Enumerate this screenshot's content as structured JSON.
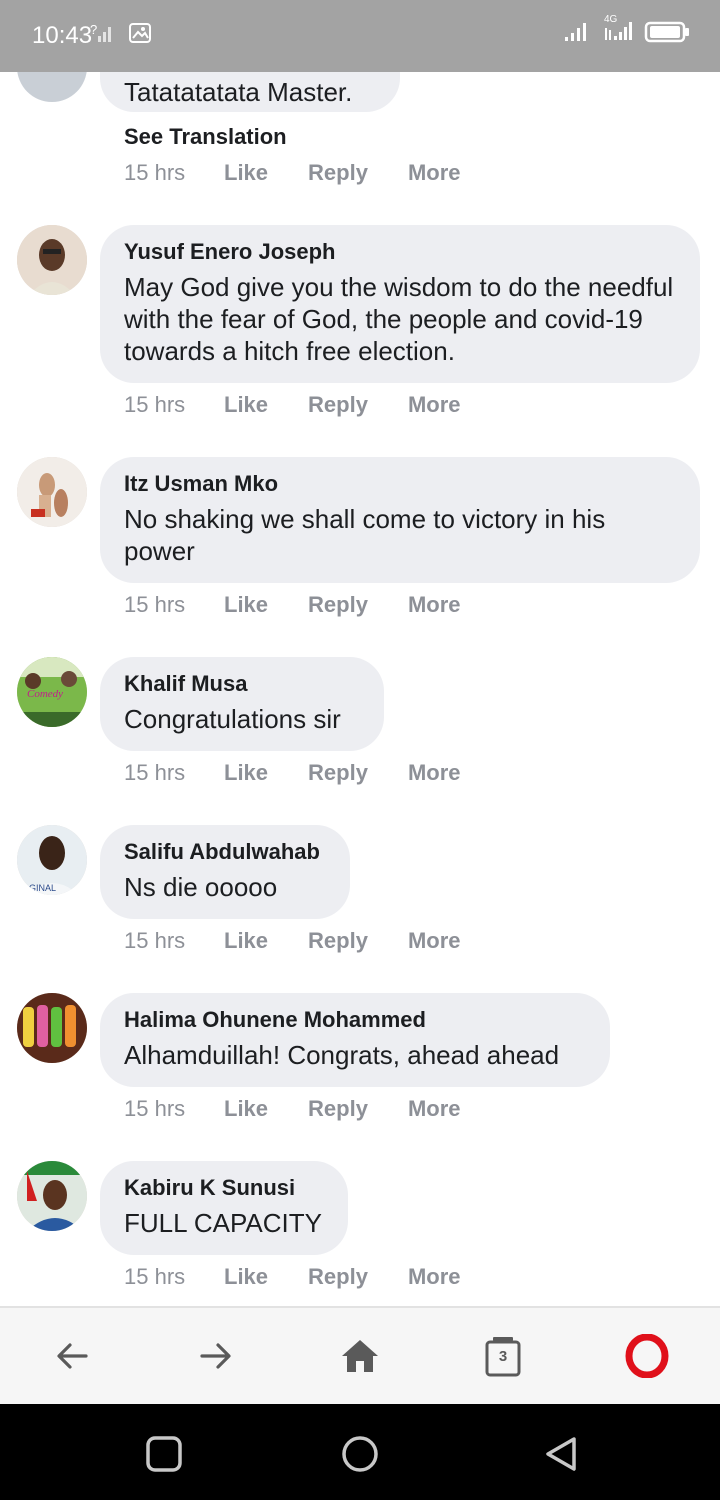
{
  "status_bar": {
    "time": "10:43",
    "network_label": "4G",
    "icons": [
      "signal-unknown-icon",
      "image-icon",
      "signal-icon",
      "battery-icon"
    ]
  },
  "top_comment": {
    "text": "Tatatatatata Master.",
    "see_translation": "See Translation",
    "time": "15 hrs",
    "like": "Like",
    "reply": "Reply",
    "more": "More"
  },
  "comments": [
    {
      "author": "Yusuf Enero Joseph",
      "text": "May God give you the wisdom to do the needful with the fear of God, the people and covid-19 towards a hitch free election.",
      "time": "15 hrs",
      "like": "Like",
      "reply": "Reply",
      "more": "More"
    },
    {
      "author": "Itz Usman Mko",
      "text": "No shaking we shall come to victory in his power",
      "time": "15 hrs",
      "like": "Like",
      "reply": "Reply",
      "more": "More"
    },
    {
      "author": "Khalif Musa",
      "text": "Congratulations sir",
      "time": "15 hrs",
      "like": "Like",
      "reply": "Reply",
      "more": "More"
    },
    {
      "author": "Salifu Abdulwahab",
      "text": "Ns die ooooo",
      "time": "15 hrs",
      "like": "Like",
      "reply": "Reply",
      "more": "More"
    },
    {
      "author": "Halima Ohunene Mohammed",
      "text": "Alhamduillah! Congrats, ahead ahead",
      "time": "15 hrs",
      "like": "Like",
      "reply": "Reply",
      "more": "More"
    },
    {
      "author": "Kabiru K Sunusi",
      "text": "FULL CAPACITY",
      "time": "15 hrs",
      "like": "Like",
      "reply": "Reply",
      "more": "More"
    }
  ],
  "browser_bar": {
    "tab_count": "3",
    "icons": [
      "back-arrow-icon",
      "forward-arrow-icon",
      "home-icon",
      "tabs-icon",
      "opera-icon"
    ]
  },
  "colors": {
    "status_bar": "#a3a3a3",
    "bubble": "#edeef2",
    "meta_text": "#8d9097",
    "opera_red": "#e0101a"
  }
}
